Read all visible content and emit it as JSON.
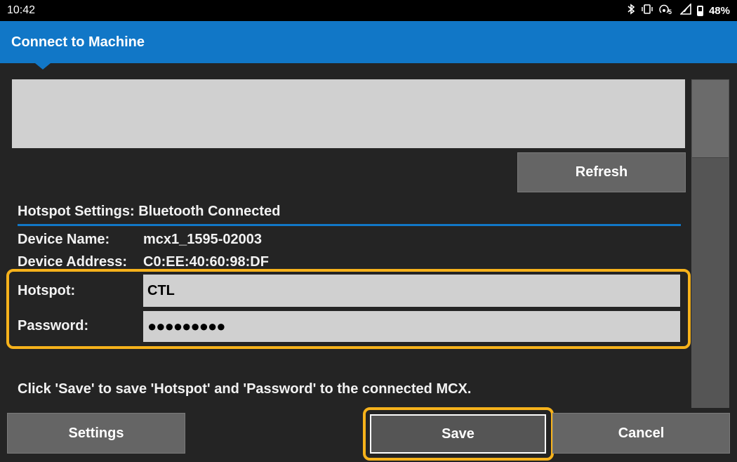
{
  "status_bar": {
    "time": "10:42",
    "battery_percent": "48%",
    "icons": [
      "bluetooth-icon",
      "vibrate-icon",
      "wifi-hotspot-icon",
      "signal-icon",
      "battery-icon"
    ]
  },
  "header": {
    "title": "Connect to Machine"
  },
  "device_list": {
    "items": []
  },
  "buttons": {
    "refresh": "Refresh",
    "settings": "Settings",
    "save": "Save",
    "cancel": "Cancel"
  },
  "hotspot_settings": {
    "header": "Hotspot Settings: Bluetooth Connected",
    "device_name_label": "Device Name:",
    "device_name_value": "mcx1_1595-02003",
    "device_address_label": "Device Address:",
    "device_address_value": "C0:EE:40:60:98:DF",
    "hotspot_label": "Hotspot:",
    "hotspot_value": "CTL",
    "password_label": "Password:",
    "password_value": "●●●●●●●●●"
  },
  "instruction": "Click 'Save' to save 'Hotspot' and 'Password' to the connected MCX.",
  "colors": {
    "accent": "#1177c7",
    "highlight": "#f6b21b",
    "background": "#242424",
    "field": "#d0d0d0",
    "button": "#656565"
  }
}
